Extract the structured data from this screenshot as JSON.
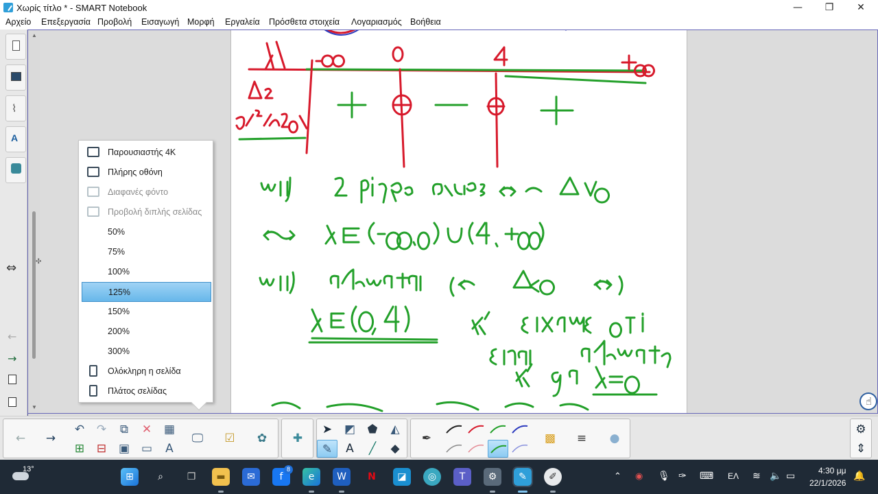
{
  "window": {
    "title": "Χωρίς τίτλο * - SMART Notebook",
    "minimize": "—",
    "maximize": "❐",
    "close": "✕"
  },
  "menu": [
    "Αρχείο",
    "Επεξεργασία",
    "Προβολή",
    "Εισαγωγή",
    "Μορφή",
    "Εργαλεία",
    "Πρόσθετα στοιχεία",
    "Λογαριασμός",
    "Βοήθεια"
  ],
  "zoom_menu": {
    "items": [
      {
        "label": "Παρουσιαστής 4K",
        "icon": "monitor-4k-icon",
        "enabled": true
      },
      {
        "label": "Πλήρης οθόνη",
        "icon": "fullscreen-icon",
        "enabled": true
      },
      {
        "label": "Διαφανές φόντο",
        "icon": "transparent-background-icon",
        "enabled": false
      },
      {
        "label": "Προβολή διπλής σελίδας",
        "icon": "dual-page-icon",
        "enabled": false
      },
      {
        "label": "50%"
      },
      {
        "label": "75%"
      },
      {
        "label": "100%"
      },
      {
        "label": "125%",
        "selected": true
      },
      {
        "label": "150%"
      },
      {
        "label": "200%"
      },
      {
        "label": "300%"
      },
      {
        "label": "Ολόκληρη η σελίδα",
        "icon": "whole-page-icon",
        "enabled": true
      },
      {
        "label": "Πλάτος σελίδας",
        "icon": "page-width-icon",
        "enabled": true
      }
    ]
  },
  "canvas": {
    "sign_table": {
      "row_var": "λ",
      "points": [
        "-∞",
        "0",
        "4",
        "+∞"
      ],
      "row_delta": "Δ₂",
      "row_expr": "5λ²-20λ",
      "signs": [
        "+",
        "0",
        "−",
        "0",
        "+"
      ]
    },
    "lines": [
      "(i) 2 ρίζες άνισες ⇔ Δ>0",
      "⇔ λ∈(-∞,0)∪(4,+∞)",
      "(ii) αδύνατη ⇔ Δ<0 ⇔",
      "λ∈(0,4)",
      "κι είχαμε ότι",
      "είναι αδύνατη",
      "κι για λ=0"
    ]
  },
  "taskbar": {
    "weather": "13°",
    "lang": "ΕΛ",
    "time": "4:30 μμ",
    "date": "22/1/2026",
    "edge_badge": "8"
  },
  "colors": {
    "ink_red": "#d7192b",
    "ink_green": "#23a02a",
    "selected_blue": "#7cc2ef"
  }
}
